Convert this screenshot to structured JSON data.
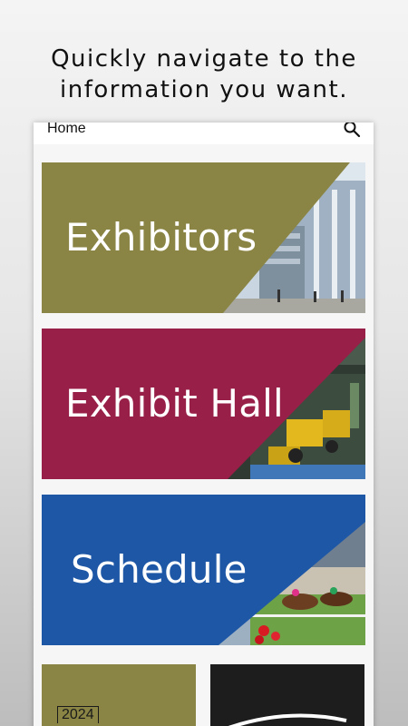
{
  "promo": {
    "line1": "Quickly navigate to the",
    "line2": "information you want."
  },
  "app_bar": {
    "title": "Home",
    "search_icon": "search-icon"
  },
  "tiles": [
    {
      "label": "Exhibitors",
      "color": "#8a8544",
      "image": "convention-center-photo"
    },
    {
      "label": "Exhibit Hall",
      "color": "#981f47",
      "image": "exhibit-floor-photo"
    },
    {
      "label": "Schedule",
      "color": "#1e57a6",
      "image": "horse-race-photo"
    }
  ],
  "bottom_tiles": [
    {
      "text": "2024",
      "color": "#8a8544"
    },
    {
      "color": "#1d1d1d",
      "image": "dark-logo-arc"
    }
  ]
}
